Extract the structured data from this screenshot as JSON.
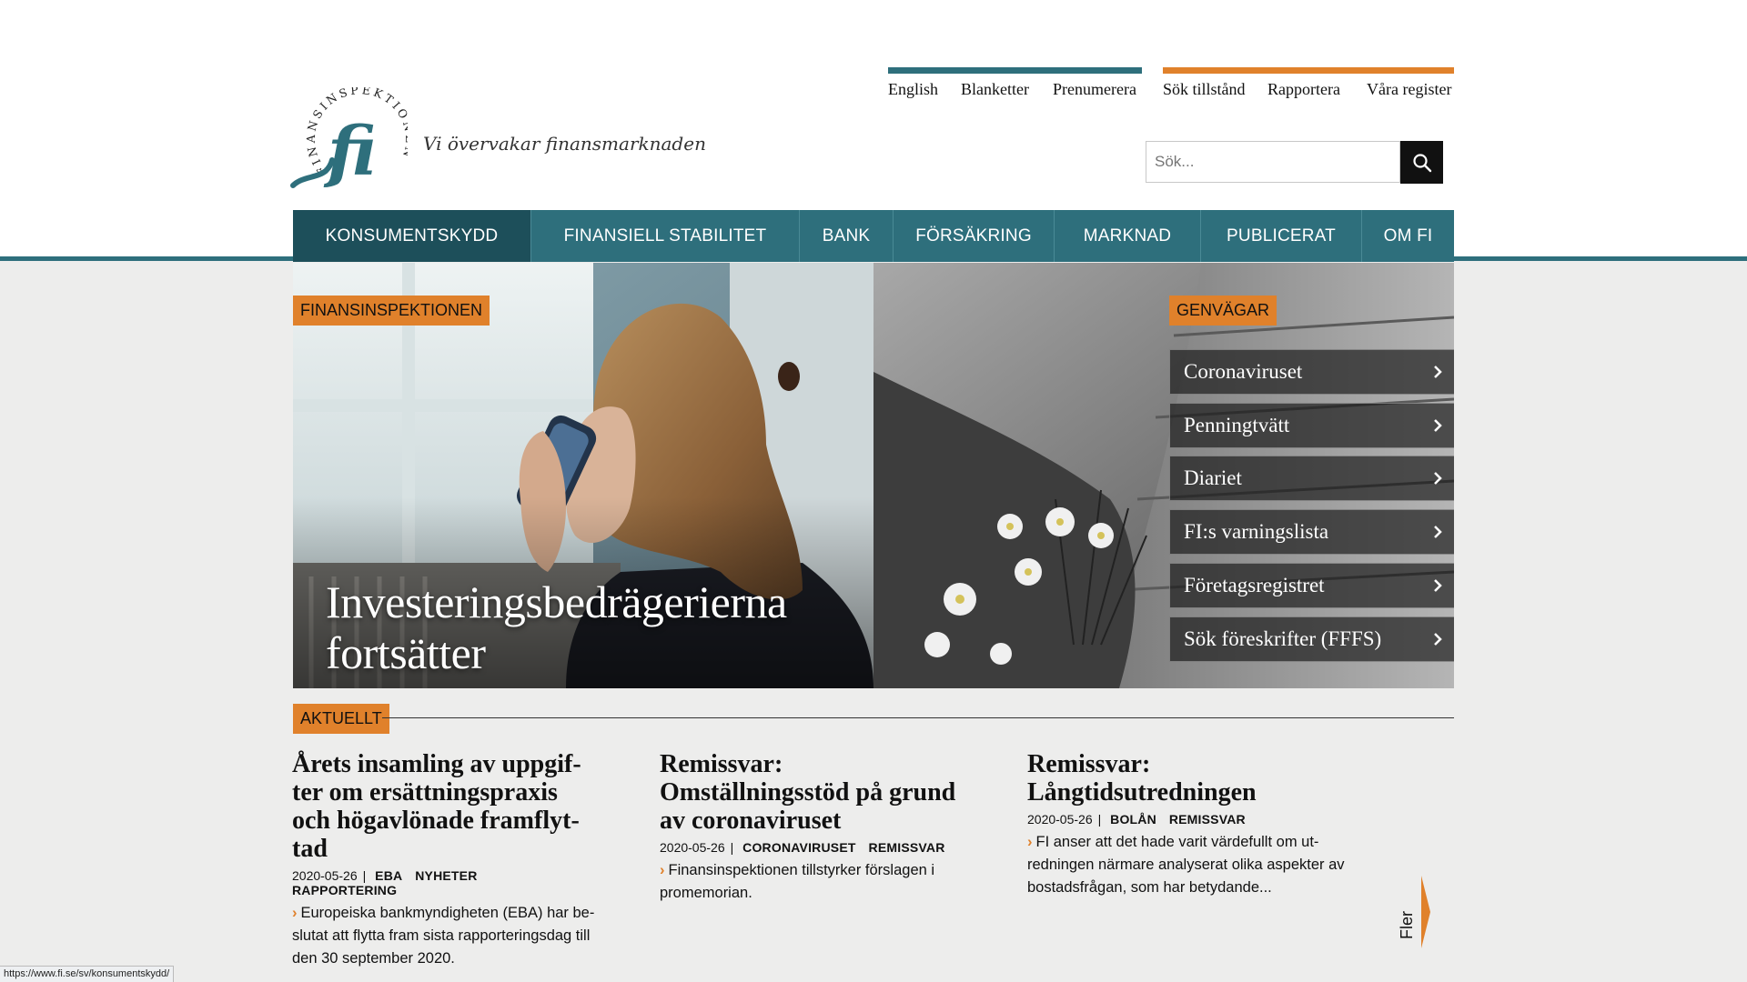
{
  "colors": {
    "teal": "#2e6f7c",
    "teal_dark": "#1d4f5a",
    "orange": "#e0812b",
    "background": "#ededec"
  },
  "brand": {
    "logo_ring_text": "FINANSINSPEKTIONEN",
    "logo_mark": "fi",
    "tagline": "Vi övervakar finansmarknaden"
  },
  "top_links": {
    "group1": [
      "English",
      "Blanketter",
      "Prenumerera"
    ],
    "group2": [
      "Sök tillstånd",
      "Rapportera",
      "Våra register"
    ]
  },
  "search": {
    "placeholder": "Sök...",
    "icon": "search-icon"
  },
  "nav": {
    "items": [
      "KONSUMENTSKYDD",
      "FINANSIELL STABILITET",
      "BANK",
      "FÖRSÄKRING",
      "MARKNAD",
      "PUBLICERAT",
      "OM FI"
    ],
    "active": "KONSUMENTSKYDD"
  },
  "hero": {
    "tag": "FINANSINSPEKTIONEN",
    "title": "Investeringsbedrägerierna fortsätter"
  },
  "shortcuts": {
    "tag": "GENVÄGAR",
    "items": [
      "Coronaviruset",
      "Penningtvätt",
      "Diariet",
      "FI:s varningslista",
      "Företagsregistret",
      "Sök föreskrifter (FFFS)"
    ]
  },
  "news": {
    "tag": "AKTUELLT",
    "items": [
      {
        "title": "Årets insamling av uppgif­ter om ersättningspraxis och högavlönade framflyt­tad",
        "date": "2020-05-26",
        "tags": [
          "EBA",
          "NYHETER",
          "RAPPORTERING"
        ],
        "text": "Europeiska bankmyndigheten (EBA) har be­slutat att flytta fram sista rapporteringsdag till den 30 september 2020."
      },
      {
        "title": "Remissvar: Omställningsstöd på grund av coronaviruset",
        "date": "2020-05-26",
        "tags": [
          "CORONAVIRUSET",
          "REMISSVAR"
        ],
        "text": "Finansinspektionen tillstyrker förslagen i promemorian."
      },
      {
        "title": "Remissvar: Långtidsutredningen",
        "date": "2020-05-26",
        "tags": [
          "BOLÅN",
          "REMISSVAR"
        ],
        "text": "FI anser att det hade varit värdefullt om ut­redningen närmare analyserat olika aspekter av bostadsfrågan, som har betydande..."
      }
    ],
    "more_label": "Fler"
  },
  "status_url": "https://www.fi.se/sv/konsumentskydd/"
}
